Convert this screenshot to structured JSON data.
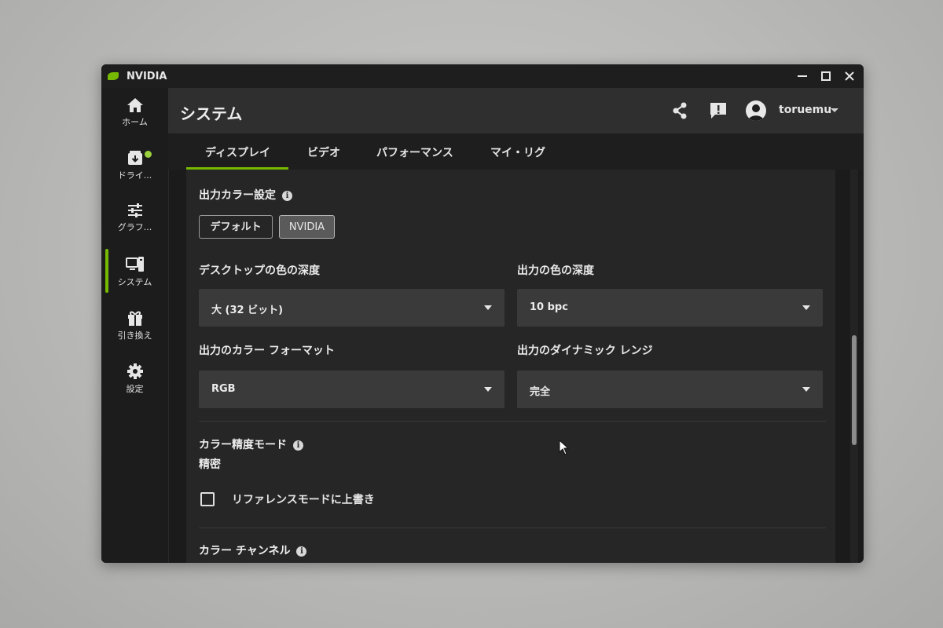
{
  "window": {
    "app_title": "NVIDIA",
    "controls": [
      "minimize-icon",
      "maximize-icon",
      "close-icon"
    ]
  },
  "sidebar": {
    "items": [
      {
        "label": "ホーム",
        "icon": "home-icon"
      },
      {
        "label": "ドライ...",
        "icon": "driver-download-icon",
        "badge": "notification-dot"
      },
      {
        "label": "グラフ...",
        "icon": "sliders-icon"
      },
      {
        "label": "システム",
        "icon": "system-icon",
        "active": true
      },
      {
        "label": "引き換え",
        "icon": "gift-icon"
      },
      {
        "label": "設定",
        "icon": "gear-icon"
      }
    ]
  },
  "header": {
    "title": "システム",
    "icons": [
      "share-icon",
      "feedback-icon"
    ],
    "user": {
      "name": "toruemu",
      "icon": "avatar-icon"
    }
  },
  "tabs": [
    {
      "label": "ディスプレイ",
      "active": true
    },
    {
      "label": "ビデオ"
    },
    {
      "label": "パフォーマンス"
    },
    {
      "label": "マイ・リグ"
    }
  ],
  "content": {
    "output_color_settings": {
      "title": "出力カラー設定",
      "options": [
        "デフォルト",
        "NVIDIA"
      ],
      "selected": "NVIDIA"
    },
    "desktop_color_depth": {
      "label": "デスクトップの色の深度",
      "value": "大 (32 ビット)"
    },
    "output_color_depth": {
      "label": "出力の色の深度",
      "value": "10 bpc"
    },
    "output_color_format": {
      "label": "出力のカラー フォーマット",
      "value": "RGB"
    },
    "output_dynamic_range": {
      "label": "出力のダイナミック レンジ",
      "value": "完全"
    },
    "color_accuracy_mode": {
      "title": "カラー精度モード",
      "value": "精密"
    },
    "override_reference_mode": {
      "label": "リファレンスモードに上書き",
      "checked": false
    },
    "color_channel": {
      "title": "カラー チャンネル"
    }
  },
  "colors": {
    "accent": "#76b900",
    "background": "#1b1b1b",
    "panel": "#262626",
    "header": "#2f2f2f",
    "dropdown": "#3a3a3a"
  }
}
